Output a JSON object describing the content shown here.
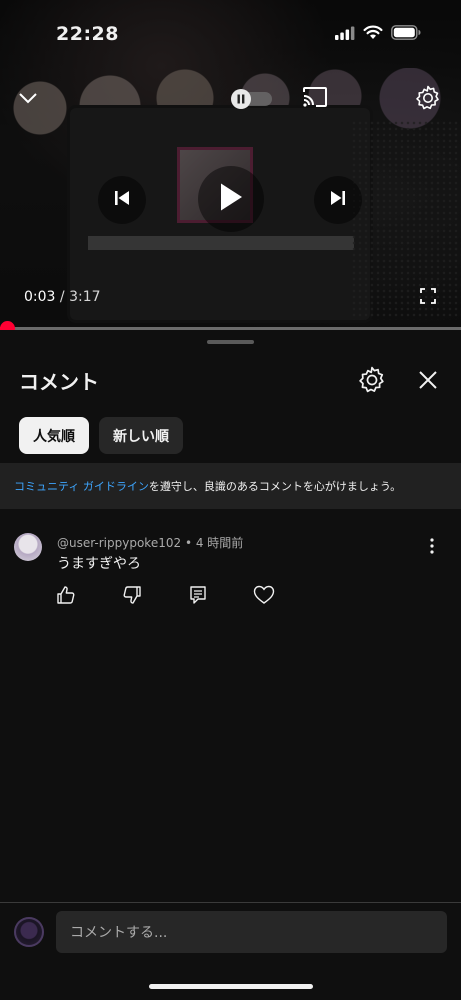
{
  "status_bar": {
    "time": "22:28",
    "icons": [
      "cellular-signal-icon",
      "wifi-icon",
      "battery-icon"
    ]
  },
  "player": {
    "current_time": "0:03",
    "separator": "/",
    "duration": "3:17",
    "progress_fraction": 0.015,
    "controls": [
      "chevron-down-icon",
      "autoplay-toggle",
      "cast-icon",
      "gear-icon",
      "previous-icon",
      "play-icon",
      "next-icon",
      "fullscreen-icon"
    ]
  },
  "comments": {
    "title": "コメント",
    "sort_chips": [
      {
        "label": "人気順",
        "active": true
      },
      {
        "label": "新しい順",
        "active": false
      }
    ],
    "guideline": {
      "link_text": "コミュニティ ガイドライン",
      "rest_text": "を遵守し、良識のあるコメントを心がけましょう。"
    },
    "items": [
      {
        "author": "@user-rippypoke102",
        "bullet": "•",
        "age": "4 時間前",
        "text": "うますぎやろ",
        "actions": [
          "like-icon",
          "dislike-icon",
          "reply-icon",
          "heart-icon"
        ]
      }
    ],
    "composer": {
      "placeholder": "コメントする..."
    }
  },
  "colors": {
    "background": "#0f0f0f",
    "accent_red": "#ff0033",
    "link_blue": "#3ea6ff",
    "chip_active_bg": "#f1f1f1",
    "chip_inactive_bg": "#272727"
  }
}
